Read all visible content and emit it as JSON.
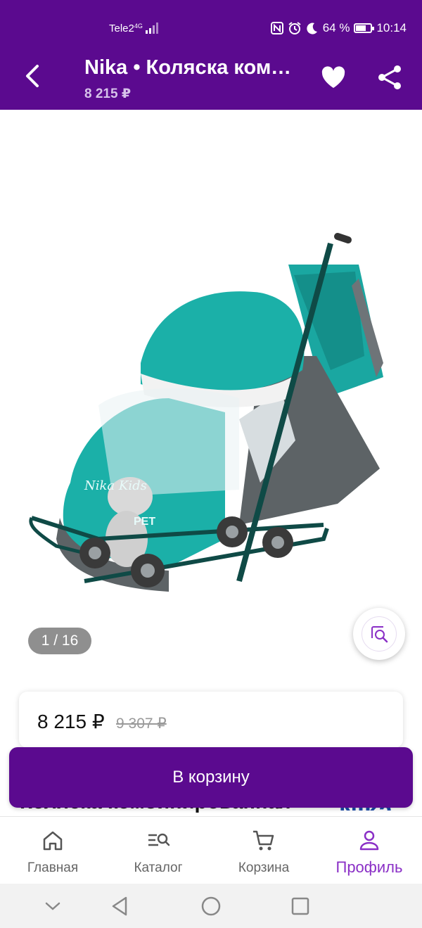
{
  "status_bar": {
    "carrier": "Tele2",
    "network": "4G",
    "battery": "64 %",
    "time": "10:14"
  },
  "app_bar": {
    "title": "Nika • Коляска комбинированная",
    "subtitle": "8 215 ₽"
  },
  "gallery": {
    "counter": "1 / 16",
    "image_text_1": "Nika Kids",
    "image_text_2": "PET"
  },
  "price": {
    "current": "8 215 ₽",
    "old": "9 307 ₽"
  },
  "behind_button": {
    "title_text": "Коляска комбинированная",
    "brand_logo": "Nika"
  },
  "cart_button": {
    "label": "В корзину"
  },
  "tab_bar": {
    "items": [
      {
        "label": "Главная",
        "icon": "home-icon"
      },
      {
        "label": "Каталог",
        "icon": "catalog-search-icon"
      },
      {
        "label": "Корзина",
        "icon": "cart-icon"
      },
      {
        "label": "Профиль",
        "icon": "profile-icon"
      }
    ],
    "active_index": 3
  },
  "colors": {
    "brand": "#5b0a8f",
    "accent": "#8a2fc6"
  }
}
